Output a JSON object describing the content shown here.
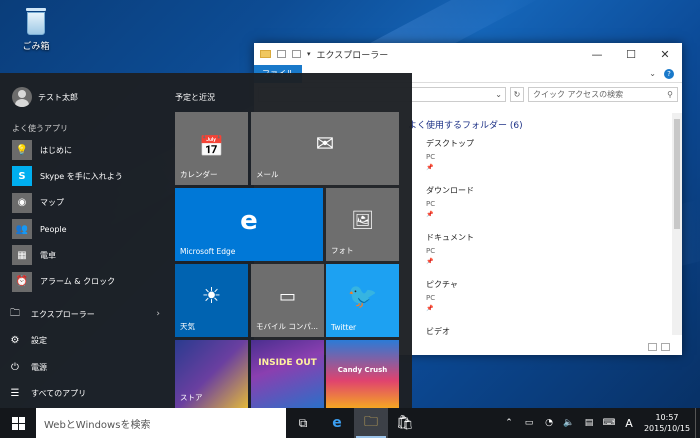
{
  "desktop": {
    "recycle_bin_label": "ごみ箱"
  },
  "explorer": {
    "title": "エクスプローラー",
    "tab_file": "ファイル",
    "search_placeholder": "クイック アクセスの検索",
    "section_header": "よく使用するフォルダー (6)",
    "folders": [
      {
        "name": "デスクトップ",
        "sub": "PC"
      },
      {
        "name": "ダウンロード",
        "sub": "PC"
      },
      {
        "name": "ドキュメント",
        "sub": "PC"
      },
      {
        "name": "ピクチャ",
        "sub": "PC"
      },
      {
        "name": "ビデオ",
        "sub": ""
      }
    ]
  },
  "start_menu": {
    "user_name": "テスト太郎",
    "most_used_header": "よく使うアプリ",
    "apps": [
      {
        "label": "はじめに",
        "icon": "lightbulb-icon",
        "color": "#6b6b6b"
      },
      {
        "label": "Skype を手に入れよう",
        "icon": "skype-icon",
        "color": "#00aff0"
      },
      {
        "label": "マップ",
        "icon": "maps-icon",
        "color": "#6b6b6b"
      },
      {
        "label": "People",
        "icon": "people-icon",
        "color": "#6b6b6b"
      },
      {
        "label": "電卓",
        "icon": "calculator-icon",
        "color": "#6b6b6b"
      },
      {
        "label": "アラーム & クロック",
        "icon": "alarm-clock-icon",
        "color": "#6b6b6b"
      }
    ],
    "system": [
      {
        "label": "エクスプローラー",
        "icon": "folder-icon"
      },
      {
        "label": "設定",
        "icon": "gear-icon"
      },
      {
        "label": "電源",
        "icon": "power-icon"
      },
      {
        "label": "すべてのアプリ",
        "icon": "all-apps-icon"
      }
    ],
    "group_title": "予定と近況",
    "tiles": {
      "calendar": "カレンダー",
      "mail": "メール",
      "edge": "Microsoft Edge",
      "photos": "フォト",
      "weather": "天気",
      "mobile": "モバイル コンパ...",
      "twitter": "Twitter",
      "store": "ストア",
      "game_inside_out": "INSIDE OUT",
      "game_candy": "Candy Crush"
    },
    "colors": {
      "gray_tile": "#6e6e6e",
      "blue_tile": "#0078d7",
      "twitter_tile": "#1da1f2",
      "weather_tile": "#0063b1"
    }
  },
  "taskbar": {
    "search_placeholder": "WebとWindowsを検索",
    "ime": "A",
    "time": "10:57",
    "date": "2015/10/15"
  }
}
